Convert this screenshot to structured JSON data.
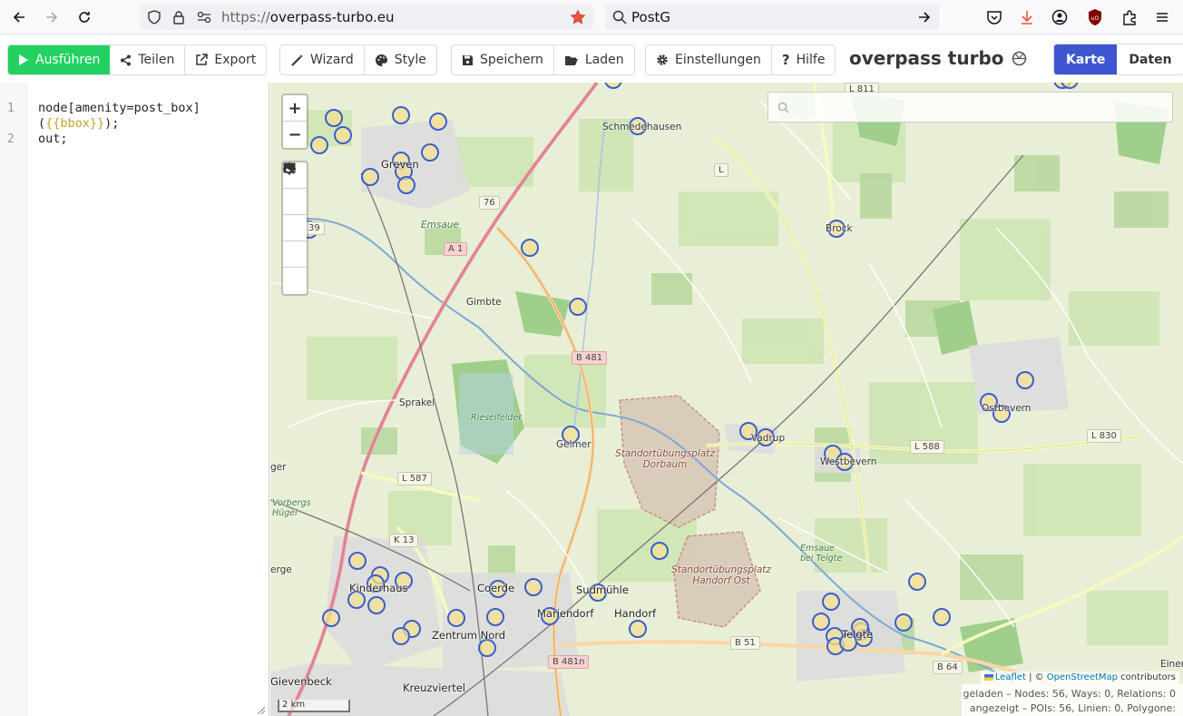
{
  "browser": {
    "url_scheme": "https://",
    "url_host": "overpass-turbo.eu",
    "search_text": "PostG",
    "icons": [
      "back-icon",
      "forward-icon",
      "reload-icon",
      "shield-icon",
      "lock-icon",
      "permissions-icon",
      "bookmark-star-icon",
      "search-icon",
      "arrow-right-icon",
      "pocket-icon",
      "download-icon",
      "account-icon",
      "ublock-icon",
      "extensions-icon",
      "menu-icon"
    ]
  },
  "toolbar": {
    "run_label": "Ausführen",
    "share_label": "Teilen",
    "export_label": "Export",
    "wizard_label": "Wizard",
    "style_label": "Style",
    "save_label": "Speichern",
    "load_label": "Laden",
    "settings_label": "Einstellungen",
    "help_label": "Hilfe",
    "app_title": "overpass turbo",
    "map_tab": "Karte",
    "data_tab": "Daten",
    "primary_color": "#23d160",
    "active_tab_color": "#3e56cf"
  },
  "editor": {
    "line_numbers": [
      "1",
      "2"
    ],
    "line1_a": "node[amenity=post_box]",
    "line1_b_open": "(",
    "line1_b_tpl": "{{bbox}}",
    "line1_b_close": ");",
    "line2": "out;"
  },
  "map": {
    "controls": [
      "zoom-in",
      "zoom-out",
      "search",
      "locate",
      "export-image",
      "previous",
      "clear"
    ],
    "zoom_in": "+",
    "zoom_out": "−",
    "places": {
      "greven": "Greven",
      "schmedehausen": "Schmedehausen",
      "emsaue": "Emsaue",
      "gimbte": "Gimbte",
      "sprakel": "Sprakel",
      "rieselfelder": "Rieselfelder",
      "gelmer": "Gelmer",
      "dorbaum": "Standortübungsplatz Dorbaum",
      "vadrup": "Vadrup",
      "westbevern": "Westbevern",
      "ostbevern": "Ostbevern",
      "brock": "Brock",
      "vorbergs": "Vorbergs Hügel",
      "kinderhaus": "Kinderhaus",
      "coerde": "Coerde",
      "sudmuehle": "Sudmühle",
      "mariendorf": "Mariendorf",
      "handorf": "Handorf",
      "handorf_ost": "Standortübungsplatz Handorf Ost",
      "emsaue_telgte": "Emsaue bei Telgte",
      "telgte": "Telgte",
      "zentrum_nord": "Zentrum Nord",
      "kreuzviertel": "Kreuzviertel",
      "gievenbeck": "Gievenbeck",
      "einen": "Einen",
      "ger": "ger",
      "erge": "erge",
      "num39": "39"
    },
    "shields": {
      "a1": "A 1",
      "n76": "76",
      "b481": "B 481",
      "b481n": "B 481n",
      "b51": "B 51",
      "b64": "B 64",
      "l587": "L 587",
      "l588": "L 588",
      "l830": "L 830",
      "l811": "L 811",
      "k13": "K 13",
      "l_small": "L"
    },
    "scale": "2 km",
    "attribution_leaflet": "Leaflet",
    "attribution_sep": " | © ",
    "attribution_osm": "OpenStreetMap",
    "attribution_tail": " contributors",
    "stats_loaded": "geladen – Nodes: 56, Ways: 0, Relations: 0",
    "stats_shown": "angezeigt – POIs: 56, Linien: 0, Polygone: 0"
  }
}
